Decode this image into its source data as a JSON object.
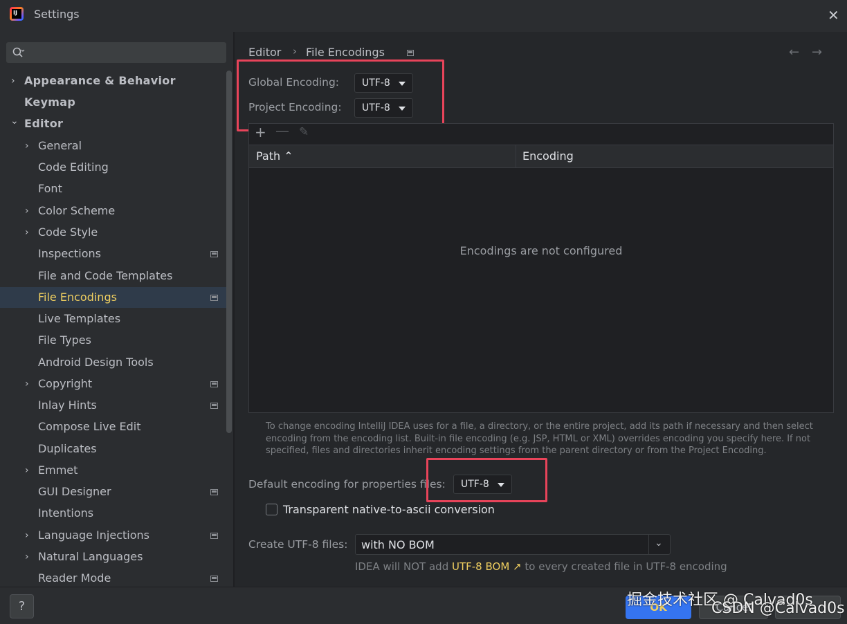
{
  "window": {
    "title": "Settings",
    "logo_text": "IJ"
  },
  "sidebar": {
    "search_placeholder": "",
    "items": [
      {
        "label": "Appearance & Behavior",
        "chevron": "›"
      },
      {
        "label": "Keymap"
      },
      {
        "label": "Editor",
        "chevron": "⌄"
      },
      {
        "label": "General",
        "chevron": "›"
      },
      {
        "label": "Code Editing"
      },
      {
        "label": "Font"
      },
      {
        "label": "Color Scheme",
        "chevron": "›"
      },
      {
        "label": "Code Style",
        "chevron": "›"
      },
      {
        "label": "Inspections"
      },
      {
        "label": "File and Code Templates"
      },
      {
        "label": "File Encodings"
      },
      {
        "label": "Live Templates"
      },
      {
        "label": "File Types"
      },
      {
        "label": "Android Design Tools"
      },
      {
        "label": "Copyright",
        "chevron": "›"
      },
      {
        "label": "Inlay Hints"
      },
      {
        "label": "Compose Live Edit"
      },
      {
        "label": "Duplicates"
      },
      {
        "label": "Emmet",
        "chevron": "›"
      },
      {
        "label": "GUI Designer"
      },
      {
        "label": "Intentions"
      },
      {
        "label": "Language Injections",
        "chevron": "›"
      },
      {
        "label": "Natural Languages",
        "chevron": "›"
      },
      {
        "label": "Reader Mode"
      }
    ]
  },
  "breadcrumb": {
    "parent": "Editor",
    "sep": "›",
    "current": "File Encodings",
    "back": "←",
    "forward": "→"
  },
  "encoding": {
    "global_label": "Global Encoding:",
    "global_value": "UTF-8",
    "project_label": "Project Encoding:",
    "project_value": "UTF-8"
  },
  "table": {
    "add": "+",
    "remove": "—",
    "edit": "✎",
    "col_path": "Path ⌃",
    "col_encoding": "Encoding",
    "empty": "Encodings are not configured"
  },
  "hint": "To change encoding IntelliJ IDEA uses for a file, a directory, or the entire project, add its path if necessary and then select encoding from the encoding list. Built-in file encoding (e.g. JSP, HTML or XML) overrides encoding you specify here. If not specified, files and directories inherit encoding settings from the parent directory or from the Project Encoding.",
  "properties": {
    "label": "Default encoding for properties files:",
    "value": "UTF-8"
  },
  "transparent": {
    "label": "Transparent native-to-ascii conversion",
    "checked": false
  },
  "bom": {
    "label": "Create UTF-8 files:",
    "value": "with NO BOM",
    "chevron": "⌄",
    "note_prefix": "IDEA will NOT add",
    "note_link": "UTF-8 BOM ↗",
    "note_suffix": "to every created file in UTF-8 encoding"
  },
  "footer": {
    "help": "?",
    "ok": "OK",
    "cancel": "Cancel",
    "watermark_1": "掘金技术社区 @ Calvad0s",
    "watermark_2": "CSDN @Calvad0s"
  },
  "colors": {
    "accent": "#3574f0",
    "selected_text": "#f0cf60",
    "highlight": "#e8445a"
  }
}
